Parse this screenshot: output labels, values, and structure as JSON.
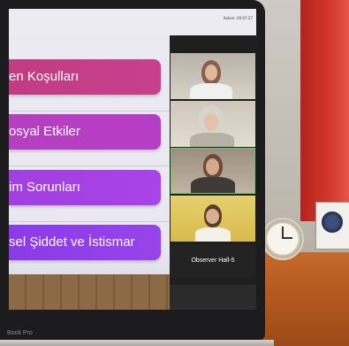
{
  "slide": {
    "items": [
      {
        "label": "en Koşulları"
      },
      {
        "label": "osyal Etkiler"
      },
      {
        "label": "im Sorunları"
      },
      {
        "label": "sel Şiddet ve İstismar"
      }
    ],
    "topbar_text": "Kalem: 00:07:27"
  },
  "video_call": {
    "observer_label": "Observer Hall-5"
  },
  "laptop": {
    "brand_text": "Book Pro"
  }
}
